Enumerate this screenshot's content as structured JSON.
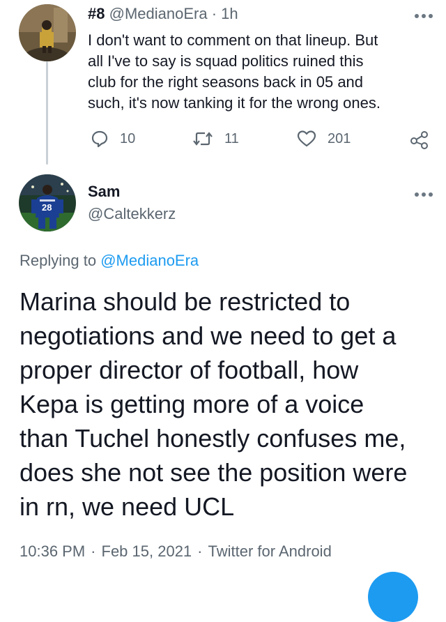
{
  "tweet1": {
    "name": "#8",
    "handle": "@MedianoEra",
    "dot": "·",
    "time": "1h",
    "more_icon": "more-horizontal-icon",
    "text": [
      "I don't want to comment on that lineup. But",
      "all I've to say is squad politics ruined this",
      "club for the right seasons back in 05 and",
      "such, it's now tanking it for the wrong ones."
    ],
    "actions": {
      "reply_count": "10",
      "retweet_count": "11",
      "like_count": "201"
    }
  },
  "tweet2": {
    "name": "Sam",
    "handle": "@Caltekkerz",
    "more_icon": "more-horizontal-icon",
    "replying_prefix": "Replying to",
    "replying_to": "@MedianoEra",
    "text": [
      "Marina should be restricted to",
      "negotiations and we need to get a",
      "proper director of football, how",
      "Kepa is getting more of a voice",
      "than Tuchel honestly confuses me,",
      "does she not see the position were",
      "in rn, we need UCL"
    ],
    "time": "10:36 PM",
    "date": "Feb 15, 2021",
    "source": "Twitter for Android",
    "sep": "·"
  },
  "colors": {
    "accent": "#1d9bf0",
    "text": "#141823",
    "muted": "#5b6670",
    "thread_line": "#c9d0d6"
  }
}
